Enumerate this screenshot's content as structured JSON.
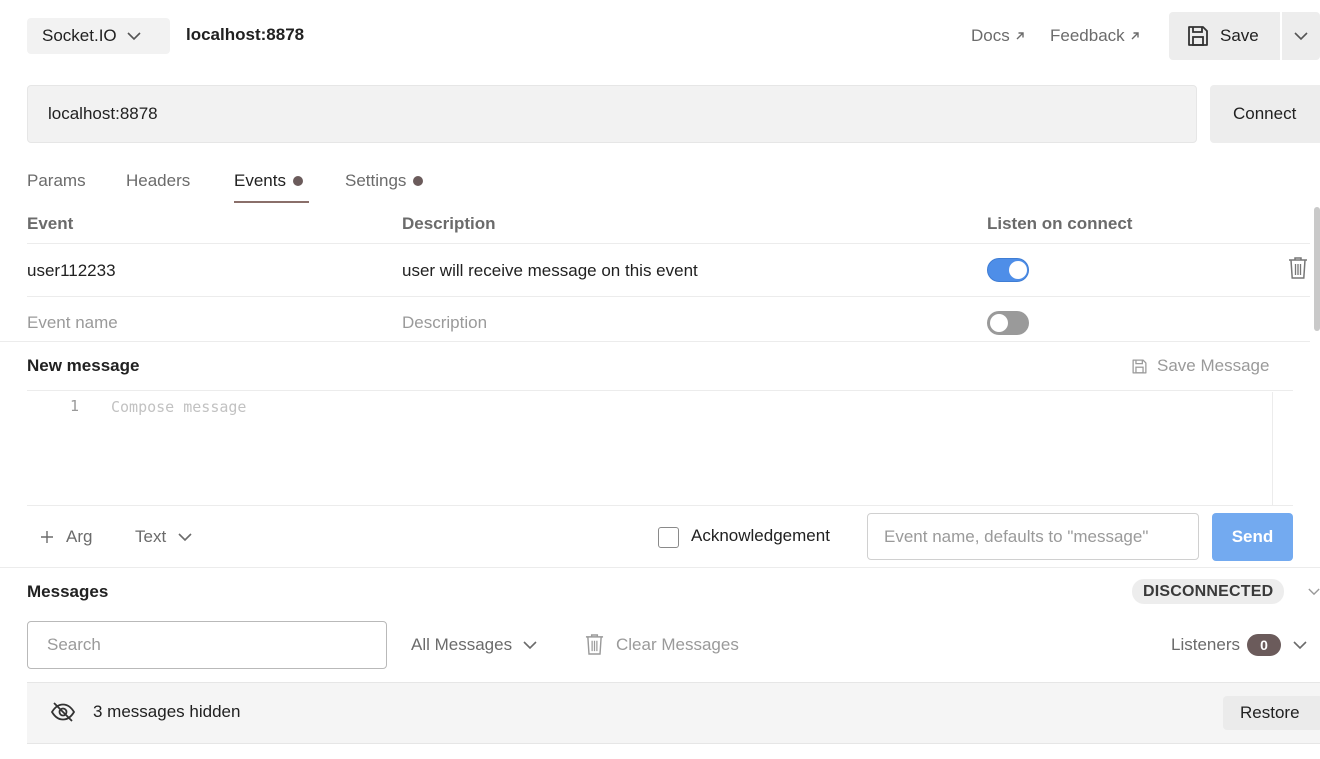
{
  "topbar": {
    "protocol": "Socket.IO",
    "request_title": "localhost:8878",
    "docs_label": "Docs",
    "feedback_label": "Feedback",
    "save_label": "Save"
  },
  "url": {
    "value": "localhost:8878",
    "connect_label": "Connect"
  },
  "tabs": [
    {
      "label": "Params",
      "dot": false,
      "active": false
    },
    {
      "label": "Headers",
      "dot": false,
      "active": false
    },
    {
      "label": "Events",
      "dot": true,
      "active": true
    },
    {
      "label": "Settings",
      "dot": true,
      "active": false
    }
  ],
  "events_table": {
    "headers": [
      "Event",
      "Description",
      "Listen on connect"
    ],
    "rows": [
      {
        "event": "user112233",
        "description": "user will receive message on this event",
        "listen": true
      }
    ],
    "new_row": {
      "event_placeholder": "Event name",
      "description_placeholder": "Description",
      "listen": false
    }
  },
  "new_message": {
    "title": "New message",
    "save_message_label": "Save Message",
    "line_number": "1",
    "editor_placeholder": "Compose message",
    "arg_label": "Arg",
    "type_label": "Text",
    "acknowledgement_label": "Acknowledgement",
    "event_name_placeholder": "Event name, defaults to \"message\"",
    "send_label": "Send"
  },
  "messages": {
    "title": "Messages",
    "status": "DISCONNECTED",
    "search_placeholder": "Search",
    "filter_label": "All Messages",
    "clear_label": "Clear Messages",
    "listeners_label": "Listeners",
    "listeners_count": "0",
    "hidden_text": "3 messages hidden",
    "restore_label": "Restore"
  },
  "colors": {
    "accent_blue": "#4e8ee8",
    "send_button": "#73aaf0",
    "tab_indicator": "#8a6f6a",
    "badge_dark": "#6b5b5b"
  }
}
